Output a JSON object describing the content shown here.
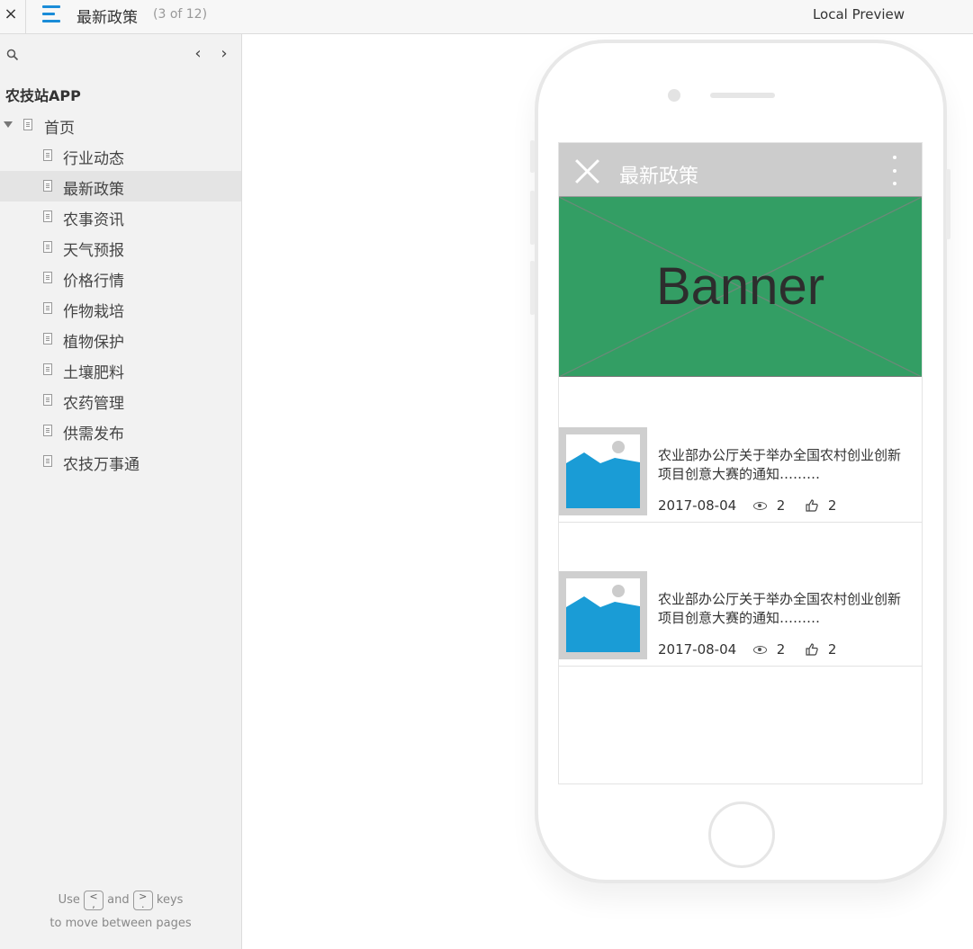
{
  "topbar": {
    "close_glyph": "×",
    "page_title": "最新政策",
    "page_count": "(3 of 12)",
    "preview_label": "Local Preview"
  },
  "sidebar": {
    "prev_glyph": "‹",
    "next_glyph": "›",
    "app_name": "农技站APP",
    "root": {
      "label": "首页",
      "expanded": true
    },
    "items": [
      {
        "label": "行业动态"
      },
      {
        "label": "最新政策",
        "active": true
      },
      {
        "label": "农事资讯"
      },
      {
        "label": "天气预报"
      },
      {
        "label": "价格行情"
      },
      {
        "label": "作物栽培"
      },
      {
        "label": "植物保护"
      },
      {
        "label": "土壤肥料"
      },
      {
        "label": "农药管理"
      },
      {
        "label": "供需发布"
      },
      {
        "label": "农技万事通"
      }
    ],
    "hint": {
      "use": "Use",
      "key_prev": "<\n,",
      "and": "and",
      "key_next": ">\n.",
      "keys": "keys",
      "line2": "to move between pages"
    }
  },
  "screen": {
    "appbar_title": "最新政策",
    "banner_text": "Banner",
    "banner_color": "#339e64",
    "news": [
      {
        "title": "农业部办公厅关于举办全国农村创业创新项目创意大赛的通知………",
        "date": "2017-08-04",
        "views": "2",
        "likes": "2"
      },
      {
        "title": "农业部办公厅关于举办全国农村创业创新项目创意大赛的通知………",
        "date": "2017-08-04",
        "views": "2",
        "likes": "2"
      }
    ]
  },
  "colors": {
    "accent": "#1a8cd8",
    "image_placeholder": "#1a9cd6",
    "appbar": "#cccccc"
  }
}
